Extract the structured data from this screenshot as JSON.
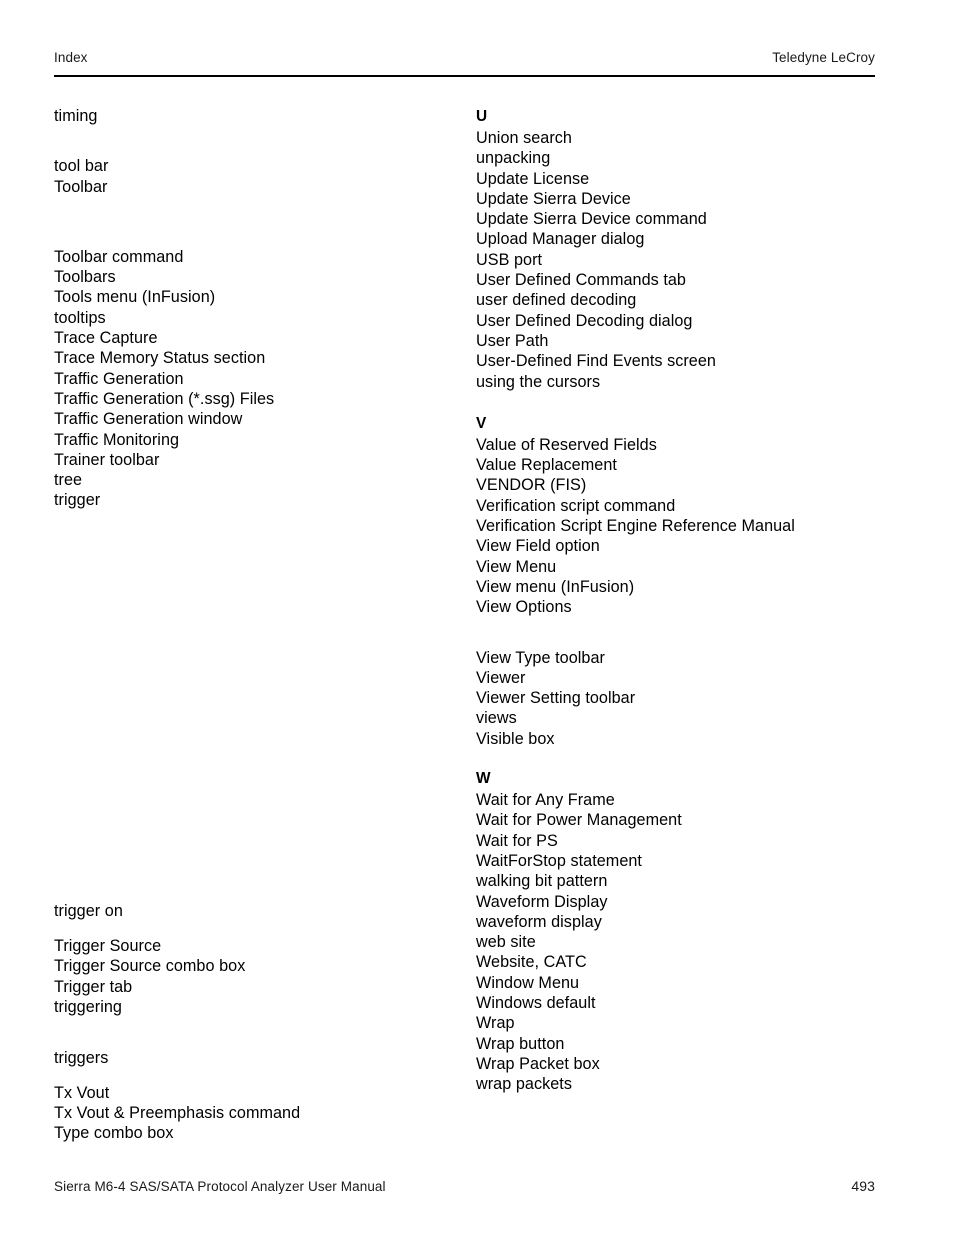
{
  "header": {
    "left": "Index",
    "right": "Teledyne LeCroy"
  },
  "footer": {
    "left": "Sierra M6-4 SAS/SATA Protocol Analyzer User Manual",
    "page_number": "493"
  },
  "columns": {
    "left": {
      "groups": [
        {
          "gap_before": 0,
          "entries": [
            {
              "text": "timing",
              "letter": false
            }
          ]
        },
        {
          "gap_before": 30,
          "entries": [
            {
              "text": "tool bar",
              "letter": false
            },
            {
              "text": "Toolbar",
              "letter": false
            }
          ]
        },
        {
          "gap_before": 50,
          "entries": [
            {
              "text": "Toolbar command",
              "letter": false
            },
            {
              "text": "Toolbars",
              "letter": false
            },
            {
              "text": "Tools menu (InFusion)",
              "letter": false
            },
            {
              "text": "tooltips",
              "letter": false
            },
            {
              "text": "Trace Capture",
              "letter": false
            },
            {
              "text": "Trace Memory Status section",
              "letter": false
            },
            {
              "text": "Traffic Generation",
              "letter": false
            },
            {
              "text": "Traffic Generation (*.ssg) Files",
              "letter": false
            },
            {
              "text": "Traffic Generation window",
              "letter": false
            },
            {
              "text": "Traffic Monitoring",
              "letter": false
            },
            {
              "text": "Trainer toolbar",
              "letter": false
            },
            {
              "text": "tree",
              "letter": false
            },
            {
              "text": "trigger",
              "letter": false
            }
          ]
        },
        {
          "gap_before": 390,
          "entries": [
            {
              "text": "trigger on",
              "letter": false
            }
          ]
        },
        {
          "gap_before": 15,
          "entries": [
            {
              "text": "Trigger Source",
              "letter": false
            },
            {
              "text": "Trigger Source combo box",
              "letter": false
            },
            {
              "text": "Trigger tab",
              "letter": false
            },
            {
              "text": "triggering",
              "letter": false
            }
          ]
        },
        {
          "gap_before": 31,
          "entries": [
            {
              "text": "triggers",
              "letter": false
            }
          ]
        },
        {
          "gap_before": 14,
          "entries": [
            {
              "text": "Tx Vout",
              "letter": false
            },
            {
              "text": "Tx Vout & Preemphasis command",
              "letter": false
            },
            {
              "text": "Type combo box",
              "letter": false
            }
          ]
        }
      ]
    },
    "right": {
      "groups": [
        {
          "gap_before": 0,
          "entries": [
            {
              "text": "U",
              "letter": true
            },
            {
              "text": "Union search",
              "letter": false
            },
            {
              "text": "unpacking",
              "letter": false
            },
            {
              "text": "Update License",
              "letter": false
            },
            {
              "text": "Update Sierra Device",
              "letter": false
            },
            {
              "text": "Update Sierra Device command",
              "letter": false
            },
            {
              "text": "Upload Manager dialog",
              "letter": false
            },
            {
              "text": "USB port",
              "letter": false
            },
            {
              "text": "User Defined Commands tab",
              "letter": false
            },
            {
              "text": "user defined decoding",
              "letter": false
            },
            {
              "text": "User Defined Decoding dialog",
              "letter": false
            },
            {
              "text": "User Path",
              "letter": false
            },
            {
              "text": "User-Defined Find Events screen",
              "letter": false
            },
            {
              "text": "using the cursors",
              "letter": false
            }
          ]
        },
        {
          "gap_before": 21,
          "entries": [
            {
              "text": "V",
              "letter": true
            },
            {
              "text": "Value of Reserved Fields",
              "letter": false
            },
            {
              "text": "Value Replacement",
              "letter": false
            },
            {
              "text": "VENDOR (FIS)",
              "letter": false
            },
            {
              "text": "Verification script command",
              "letter": false
            },
            {
              "text": "Verification Script Engine Reference Manual",
              "letter": false
            },
            {
              "text": "View Field option",
              "letter": false
            },
            {
              "text": "View Menu",
              "letter": false
            },
            {
              "text": "View menu (InFusion)",
              "letter": false
            },
            {
              "text": "View Options",
              "letter": false
            }
          ]
        },
        {
          "gap_before": 30,
          "entries": [
            {
              "text": "View Type toolbar",
              "letter": false
            },
            {
              "text": "Viewer",
              "letter": false
            },
            {
              "text": "Viewer Setting toolbar",
              "letter": false
            },
            {
              "text": "views",
              "letter": false
            },
            {
              "text": "Visible box",
              "letter": false
            }
          ]
        },
        {
          "gap_before": 19,
          "entries": [
            {
              "text": "W",
              "letter": true
            },
            {
              "text": "Wait for Any Frame",
              "letter": false
            },
            {
              "text": "Wait for Power Management",
              "letter": false
            },
            {
              "text": "Wait for PS",
              "letter": false
            },
            {
              "text": "WaitForStop statement",
              "letter": false
            },
            {
              "text": "walking bit pattern",
              "letter": false
            },
            {
              "text": "Waveform Display",
              "letter": false
            },
            {
              "text": "waveform display",
              "letter": false
            },
            {
              "text": "web site",
              "letter": false
            },
            {
              "text": "Website, CATC",
              "letter": false
            },
            {
              "text": "Window Menu",
              "letter": false
            },
            {
              "text": "Windows default",
              "letter": false
            },
            {
              "text": "Wrap",
              "letter": false
            },
            {
              "text": "Wrap button",
              "letter": false
            },
            {
              "text": "Wrap Packet box",
              "letter": false
            },
            {
              "text": "wrap packets",
              "letter": false
            }
          ]
        }
      ]
    }
  }
}
